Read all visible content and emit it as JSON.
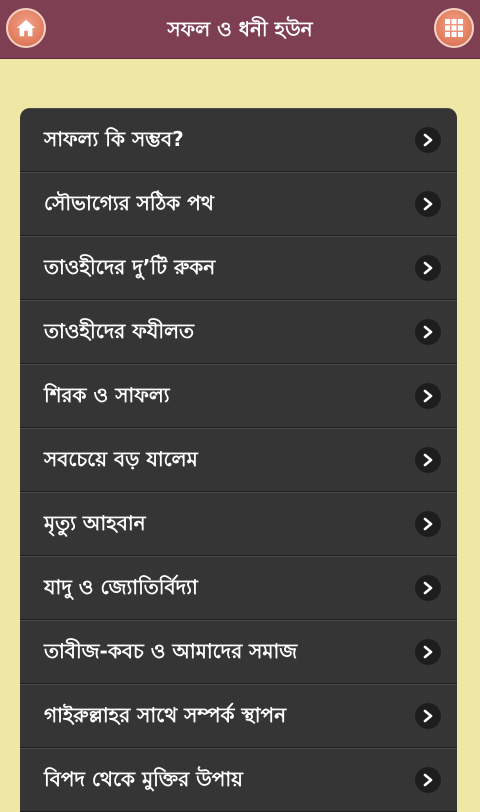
{
  "header": {
    "title": "সফল ও ধনী হউন",
    "left_icon": "home-icon",
    "right_icon": "grid-icon"
  },
  "menu": {
    "items": [
      {
        "label": "সাফল্য কি সম্ভব?"
      },
      {
        "label": "সৌভাগ্যের সঠিক পথ"
      },
      {
        "label": "তাওহীদের দু’টি রুকন"
      },
      {
        "label": "তাওহীদের ফযীলত"
      },
      {
        "label": "শিরক ও সাফল্য"
      },
      {
        "label": "সবচেয়ে বড় যালেম"
      },
      {
        "label": "মৃত্যু আহবান"
      },
      {
        "label": "যাদু ও জ্যোতির্বিদ্যা"
      },
      {
        "label": "তাবীজ-কবচ ও আমাদের সমাজ"
      },
      {
        "label": "গাইরুল্লাহর সাথে সম্পর্ক স্থাপন"
      },
      {
        "label": "বিপদ থেকে মুক্তির উপায়"
      }
    ]
  },
  "colors": {
    "header_bg": "#7f3f53",
    "page_bg": "#efe7a6",
    "list_bg": "#353535",
    "button_accent": "#e07a5c"
  }
}
